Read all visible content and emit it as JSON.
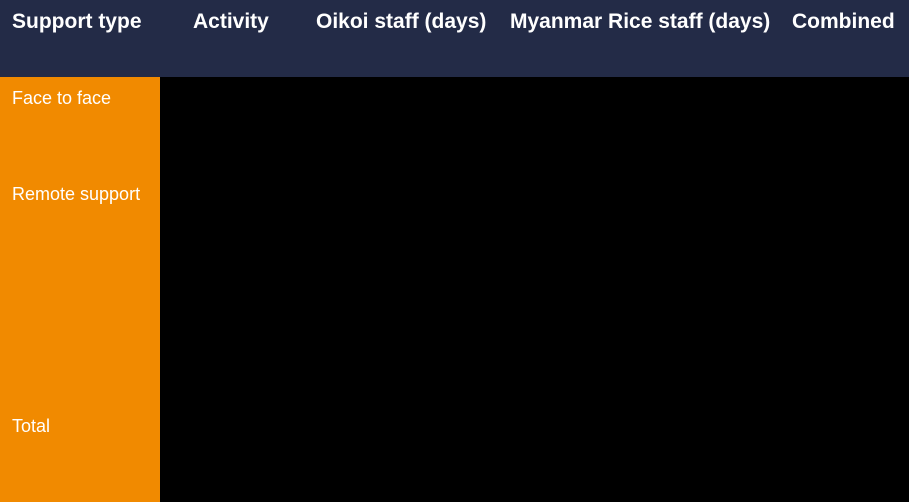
{
  "table": {
    "columns": [
      {
        "key": "support_type",
        "label": "Support type"
      },
      {
        "key": "activity",
        "label": "Activity"
      },
      {
        "key": "oikoi_staff_days",
        "label": "Oikoi staff (days)"
      },
      {
        "key": "myanmar_rice_staff_days",
        "label": "Myanmar Rice staff (days)"
      },
      {
        "key": "combined",
        "label": "Combined"
      }
    ],
    "rows": [
      {
        "support_type": "Face to face",
        "activity": "",
        "oikoi_staff_days": "",
        "myanmar_rice_staff_days": "",
        "combined": ""
      },
      {
        "support_type": "Remote support",
        "activity": "",
        "oikoi_staff_days": "",
        "myanmar_rice_staff_days": "",
        "combined": ""
      },
      {
        "support_type": "Total",
        "activity": "",
        "oikoi_staff_days": "",
        "myanmar_rice_staff_days": "",
        "combined": ""
      }
    ]
  },
  "colors": {
    "header_background": "#232b47",
    "header_text": "#ffffff",
    "row_label_background": "#f18a00",
    "row_label_text": "#ffffff",
    "body_background": "#000000"
  }
}
